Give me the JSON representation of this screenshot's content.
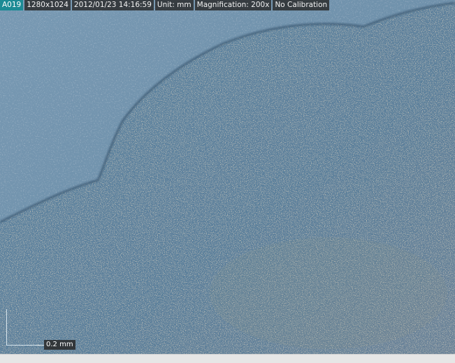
{
  "info_bar": {
    "image_id": "A019",
    "resolution": "1280x1024",
    "timestamp": "2012/01/23 14:16:59",
    "unit": "Unit: mm",
    "magnification": "Magnification:  200x",
    "calibration": "No Calibration"
  },
  "scale": {
    "label": "0.2 mm"
  },
  "colors": {
    "id_badge": "#1d8b95",
    "overlay_bg": "#282828",
    "background_region": "#6f93ae",
    "textured_region": "#5a7e9a",
    "boundary_edge": "#3d5a72"
  }
}
